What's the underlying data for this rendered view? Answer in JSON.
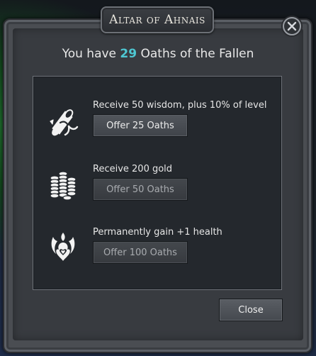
{
  "dialog": {
    "title": "Altar of Ahnais",
    "headline_prefix": "You have ",
    "oath_count": "29",
    "headline_suffix": " Oaths of the Fallen",
    "close_label": "Close",
    "accent_color": "#4ec7d2"
  },
  "rewards": [
    {
      "icon": "scroll-icon",
      "description": "Receive 50 wisdom, plus 10% of level",
      "button_label": "Offer 25 Oaths",
      "enabled": true
    },
    {
      "icon": "gold-coins-icon",
      "description": "Receive 200 gold",
      "button_label": "Offer 50 Oaths",
      "enabled": false
    },
    {
      "icon": "heart-flame-icon",
      "description": "Permanently gain +1 health",
      "button_label": "Offer 100 Oaths",
      "enabled": false
    }
  ]
}
